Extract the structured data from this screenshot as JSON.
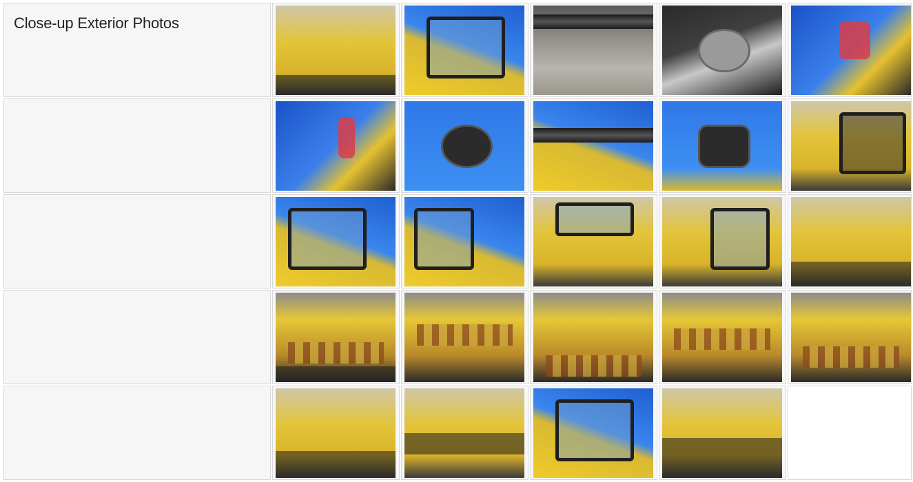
{
  "section": {
    "label": "Close-up Exterior Photos"
  },
  "photos": [
    {
      "name": "photo-cab-roof"
    },
    {
      "name": "photo-cab-door-side"
    },
    {
      "name": "photo-step-plate"
    },
    {
      "name": "photo-work-light-mount"
    },
    {
      "name": "photo-rear-tail-light"
    },
    {
      "name": "photo-tail-light-left"
    },
    {
      "name": "photo-round-work-light"
    },
    {
      "name": "photo-led-light-bar"
    },
    {
      "name": "photo-square-work-light"
    },
    {
      "name": "photo-cab-side-panel"
    },
    {
      "name": "photo-cab-front-left"
    },
    {
      "name": "photo-cab-door-open"
    },
    {
      "name": "photo-cab-rear-door"
    },
    {
      "name": "photo-cab-side-window"
    },
    {
      "name": "photo-counterweight-step"
    },
    {
      "name": "photo-hyster-side-panel"
    },
    {
      "name": "photo-rear-corner-rust"
    },
    {
      "name": "photo-top-counterweight"
    },
    {
      "name": "photo-rear-counterweight"
    },
    {
      "name": "photo-rear-quarter"
    },
    {
      "name": "photo-side-decal"
    },
    {
      "name": "photo-lower-side-panel"
    },
    {
      "name": "photo-cab-front-wide"
    },
    {
      "name": "photo-rear-view-wide"
    }
  ]
}
